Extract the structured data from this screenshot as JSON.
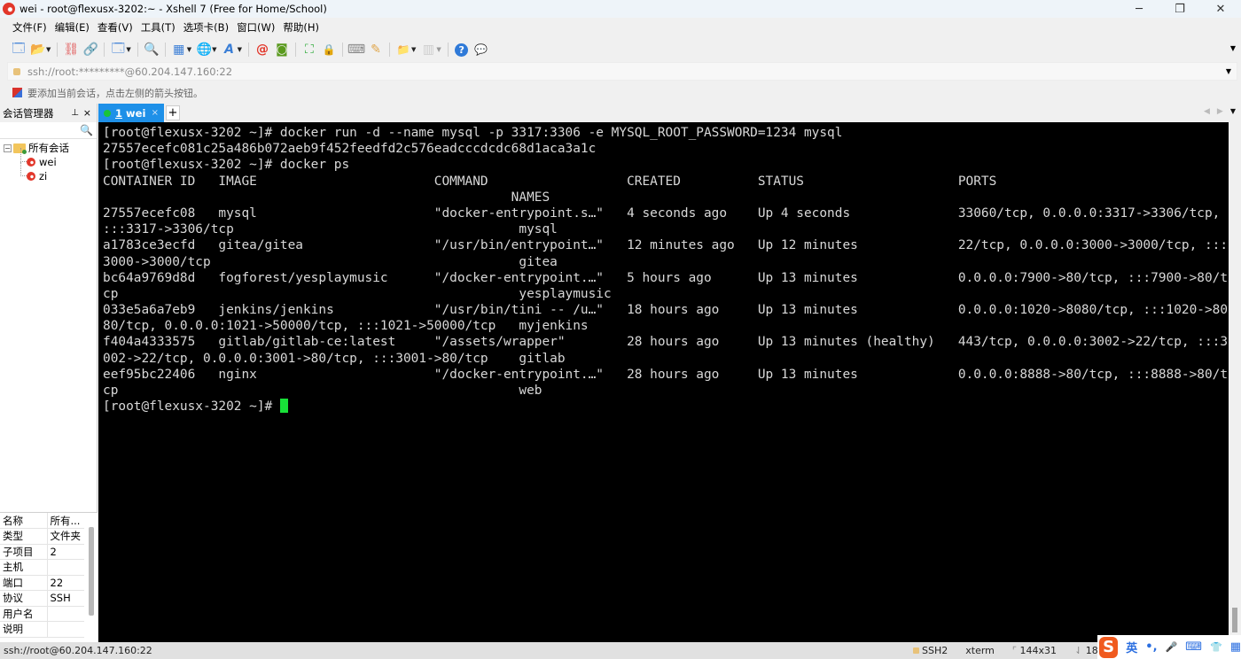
{
  "window": {
    "title": "wei - root@flexusx-3202:~ - Xshell 7 (Free for Home/School)",
    "controls": {
      "minimize": "─",
      "restore": "❐",
      "close": "✕"
    }
  },
  "menu": [
    "文件(F)",
    "编辑(E)",
    "查看(V)",
    "工具(T)",
    "选项卡(B)",
    "窗口(W)",
    "帮助(H)"
  ],
  "toolbar": {
    "icons": [
      "new-session-icon",
      "open-folder-icon",
      "reconnect-icon",
      "disconnect-icon",
      "session-properties-icon",
      "find-icon",
      "layout-icon",
      "globe-icon",
      "font-icon",
      "xshell-icon",
      "xftp-icon",
      "fullscreen-icon",
      "lock-icon",
      "keyboard-icon",
      "highlight-icon",
      "new-folder-icon",
      "split-icon",
      "help-icon",
      "chat-icon"
    ],
    "glyphs": {
      "new": "🗔",
      "folder": "📂",
      "reconnect": "⛓",
      "disconnect": "🔗",
      "props": "🗔",
      "find": "🔍",
      "layout": "▦",
      "globe": "🌐",
      "font": "A",
      "xshell": "@",
      "xftp": "◙",
      "fullscreen": "⛶",
      "lock": "🔒",
      "keyboard": "⌨",
      "highlight": "✎",
      "newfolder": "📁",
      "split": "▥",
      "help": "?",
      "chat": "💬"
    }
  },
  "address": {
    "value": "ssh://root:*********@60.204.147.160:22"
  },
  "hint": {
    "text": "要添加当前会话，点击左侧的箭头按钮。"
  },
  "sidebar": {
    "title": "会话管理器",
    "pin": "ᵖ",
    "close": "×",
    "search_placeholder": "",
    "tree": {
      "root": "所有会话",
      "children": [
        "wei",
        "zi"
      ]
    },
    "properties": [
      {
        "key": "名称",
        "value": "所有..."
      },
      {
        "key": "类型",
        "value": "文件夹"
      },
      {
        "key": "子项目",
        "value": "2"
      },
      {
        "key": "主机",
        "value": ""
      },
      {
        "key": "端口",
        "value": "22"
      },
      {
        "key": "协议",
        "value": "SSH"
      },
      {
        "key": "用户名",
        "value": ""
      },
      {
        "key": "说明",
        "value": ""
      }
    ]
  },
  "tabs": [
    {
      "number": "1",
      "label": "wei",
      "active": true,
      "close": "×"
    }
  ],
  "new_tab": "+",
  "terminal": {
    "lines": [
      "[root@flexusx-3202 ~]# docker run -d --name mysql -p 3317:3306 -e MYSQL_ROOT_PASSWORD=1234 mysql",
      "27557ecefc081c25a486b072aeb9f452feedfd2c576eadcccdcdc68d1aca3a1c",
      "[root@flexusx-3202 ~]# docker ps",
      "CONTAINER ID   IMAGE                       COMMAND                  CREATED          STATUS                    PORTS",
      "                                                     NAMES",
      "27557ecefc08   mysql                       \"docker-entrypoint.s…\"   4 seconds ago    Up 4 seconds              33060/tcp, 0.0.0.0:3317->3306/tcp,",
      ":::3317->3306/tcp                                     mysql",
      "a1783ce3ecfd   gitea/gitea                 \"/usr/bin/entrypoint…\"   12 minutes ago   Up 12 minutes             22/tcp, 0.0.0.0:3000->3000/tcp, :::",
      "3000->3000/tcp                                        gitea",
      "bc64a9769d8d   fogforest/yesplaymusic      \"/docker-entrypoint.…\"   5 hours ago      Up 13 minutes             0.0.0.0:7900->80/tcp, :::7900->80/t",
      "cp                                                    yesplaymusic",
      "033e5a6a7eb9   jenkins/jenkins             \"/usr/bin/tini -- /u…\"   18 hours ago     Up 13 minutes             0.0.0.0:1020->8080/tcp, :::1020->80",
      "80/tcp, 0.0.0.0:1021->50000/tcp, :::1021->50000/tcp   myjenkins",
      "f404a4333575   gitlab/gitlab-ce:latest     \"/assets/wrapper\"        28 hours ago     Up 13 minutes (healthy)   443/tcp, 0.0.0.0:3002->22/tcp, :::3",
      "002->22/tcp, 0.0.0.0:3001->80/tcp, :::3001->80/tcp    gitlab",
      "eef95bc22406   nginx                       \"/docker-entrypoint.…\"   28 hours ago     Up 13 minutes             0.0.0.0:8888->80/tcp, :::8888->80/t",
      "cp                                                    web"
    ],
    "prompt": "[root@flexusx-3202 ~]# ",
    "cursor_color": "#18e038",
    "background": "#000000",
    "foreground": "#d8d8d8"
  },
  "status": {
    "connection": "ssh://root@60.204.147.160:22",
    "protocol": "SSH2",
    "terminal_type": "xterm",
    "size": "144x31",
    "cursor_pos": "18,24",
    "size_prefix": "⌜",
    "pos_prefix": "⇃"
  },
  "ime": {
    "logo": "S",
    "lang": "英",
    "items": [
      "•,",
      "🎤",
      "⌨",
      "👕",
      "▦"
    ]
  },
  "colors": {
    "tab_active": "#1e90e8",
    "tab_dot": "#19c43a",
    "brand_red": "#e2372b"
  }
}
